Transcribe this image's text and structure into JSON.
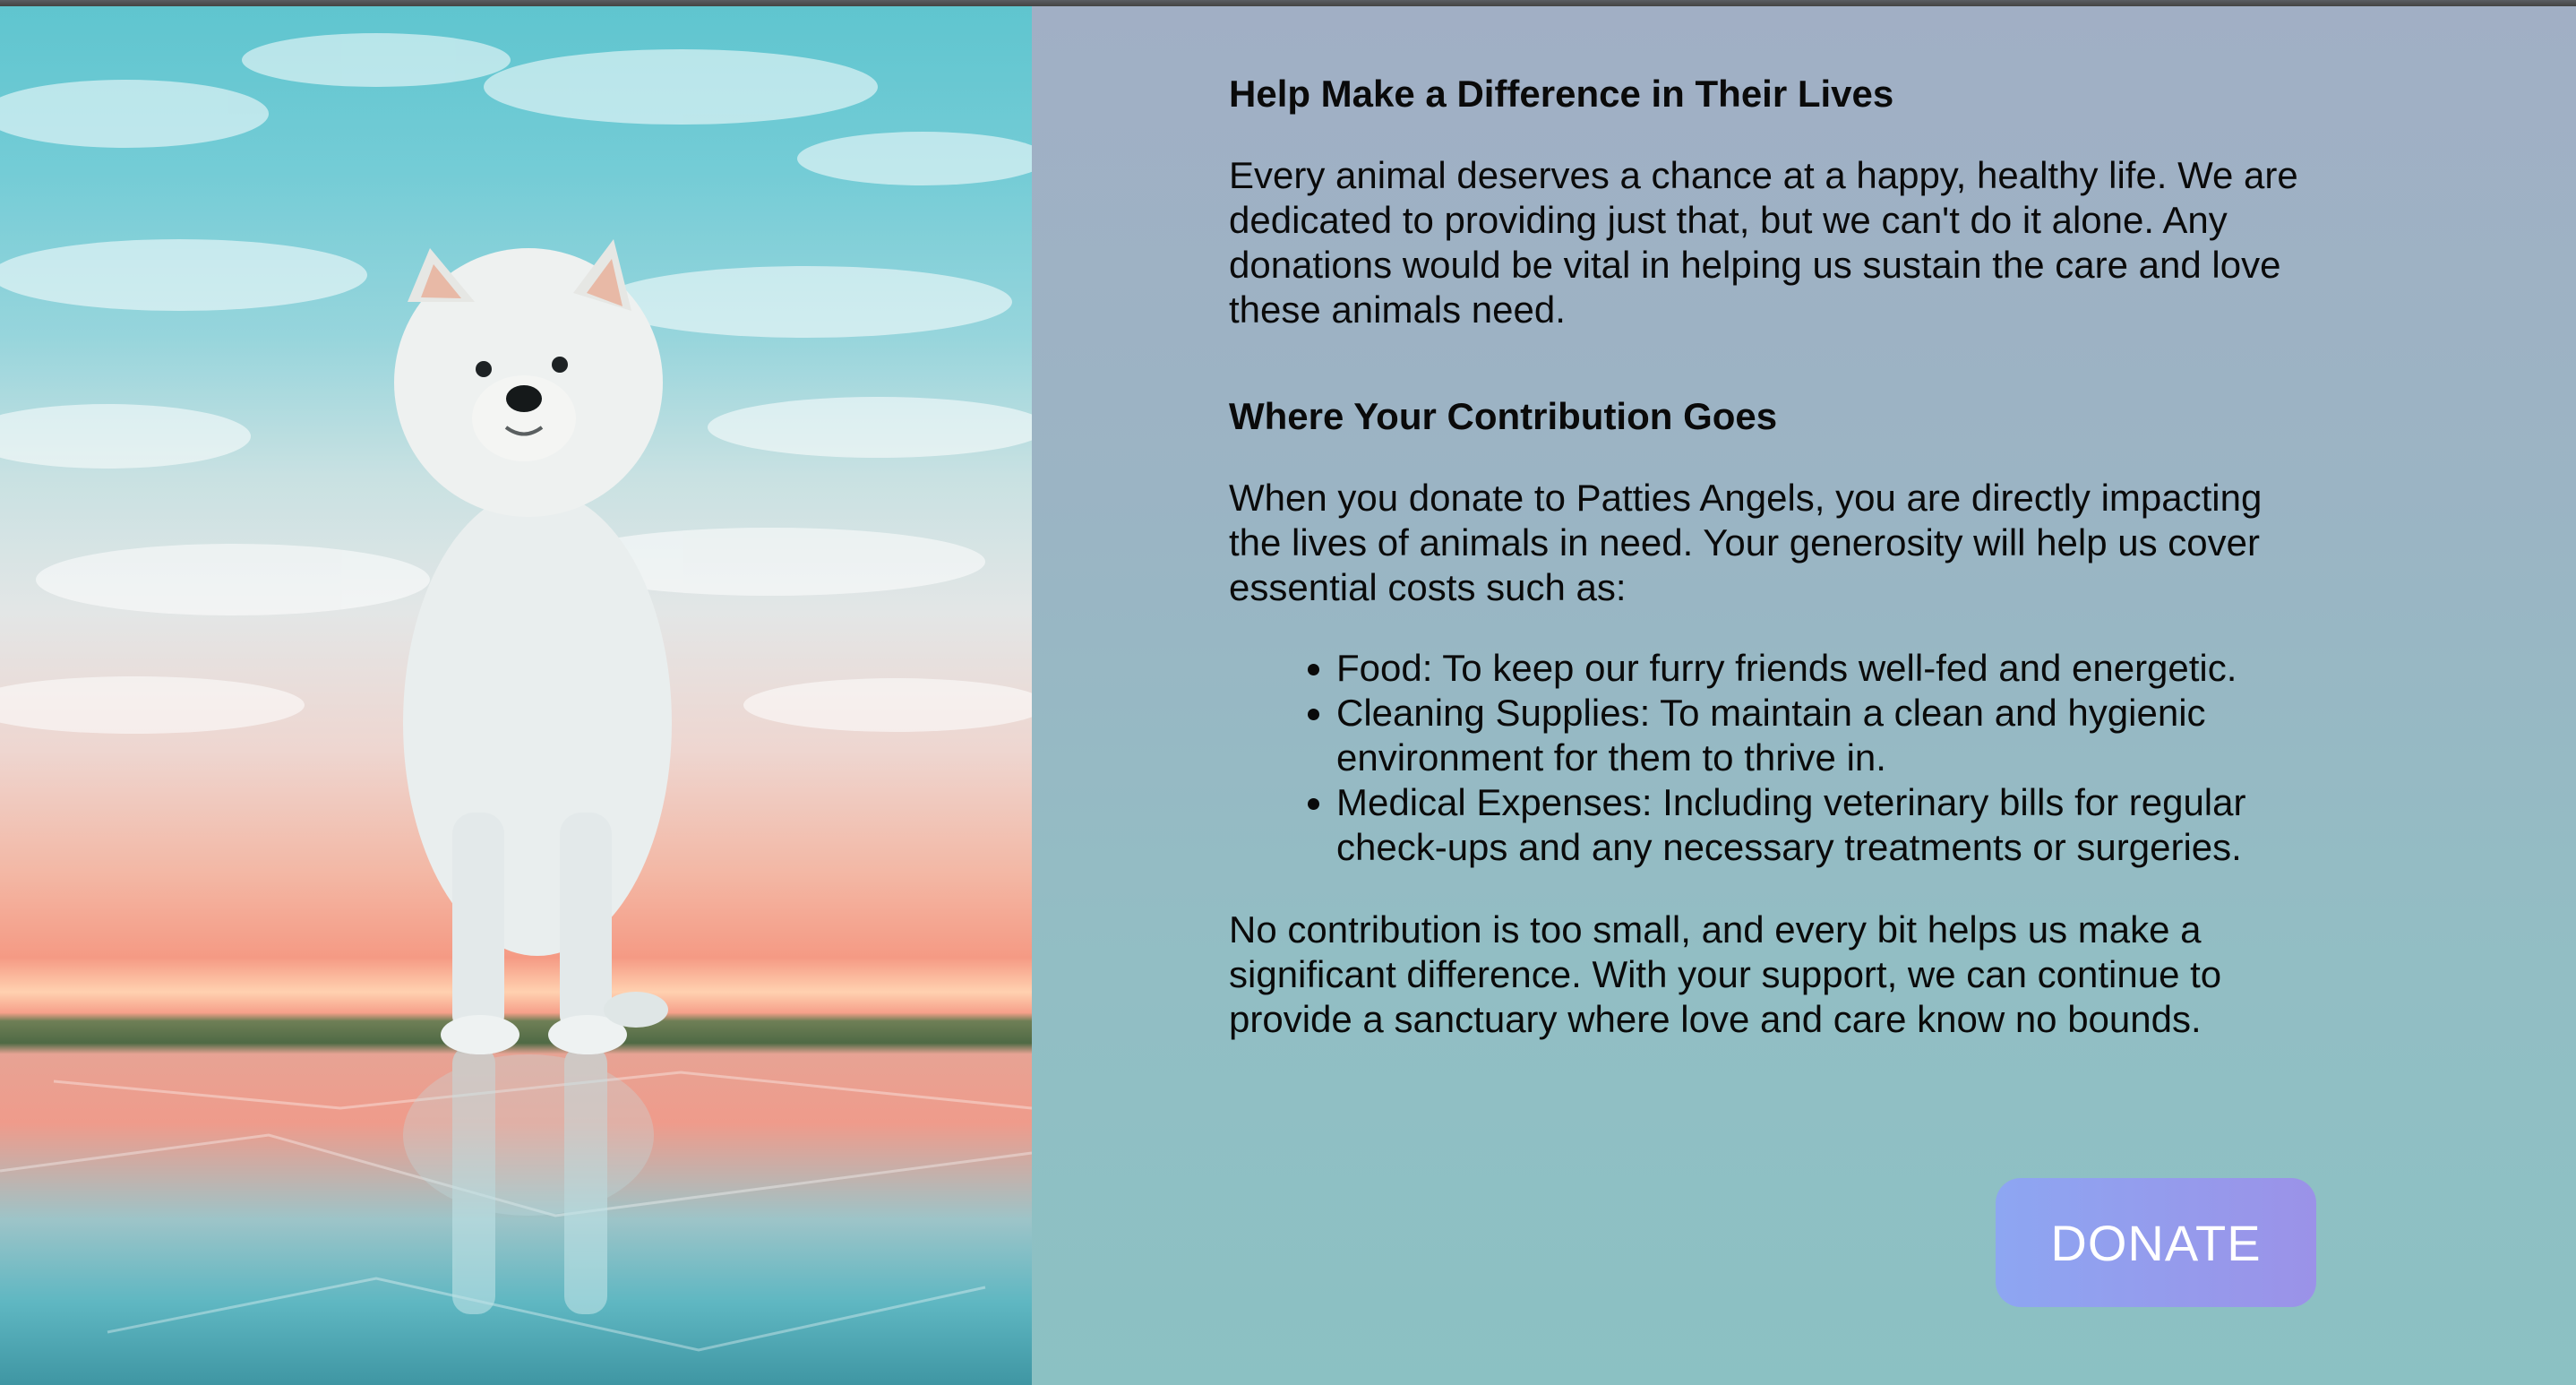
{
  "hero": {
    "image_alt": "White fluffy dog standing on frozen lake at sunset",
    "icon": "dog-photo"
  },
  "section_help": {
    "heading": "Help Make a Difference in Their Lives",
    "body": "Every animal deserves a chance at a happy, healthy life. We are dedicated to providing just that, but we can't do it alone. Any donations would be vital in helping us sustain the care and love these animals need."
  },
  "section_contribution": {
    "heading": "Where Your Contribution Goes",
    "body": "When you donate to Patties Angels, you are directly impacting the lives of animals in need. Your generosity will help us cover essential costs such as:",
    "items": [
      "Food: To keep our furry friends well-fed and energetic.",
      "Cleaning Supplies: To maintain a clean and hygienic environment for them to thrive in.",
      "Medical Expenses: Including veterinary bills for regular check-ups and any necessary treatments or surgeries."
    ],
    "closing": "No contribution is too small, and every bit helps us make a significant difference. With your support, we can continue to provide a sanctuary where love and care know no bounds."
  },
  "donate": {
    "label": "DONATE"
  },
  "colors": {
    "content_bg_top": "#a1afc5",
    "content_bg_bottom": "#8bc1c3",
    "button_start": "#8da6f2",
    "button_end": "#9b92e8",
    "text": "#0a0a0a"
  }
}
